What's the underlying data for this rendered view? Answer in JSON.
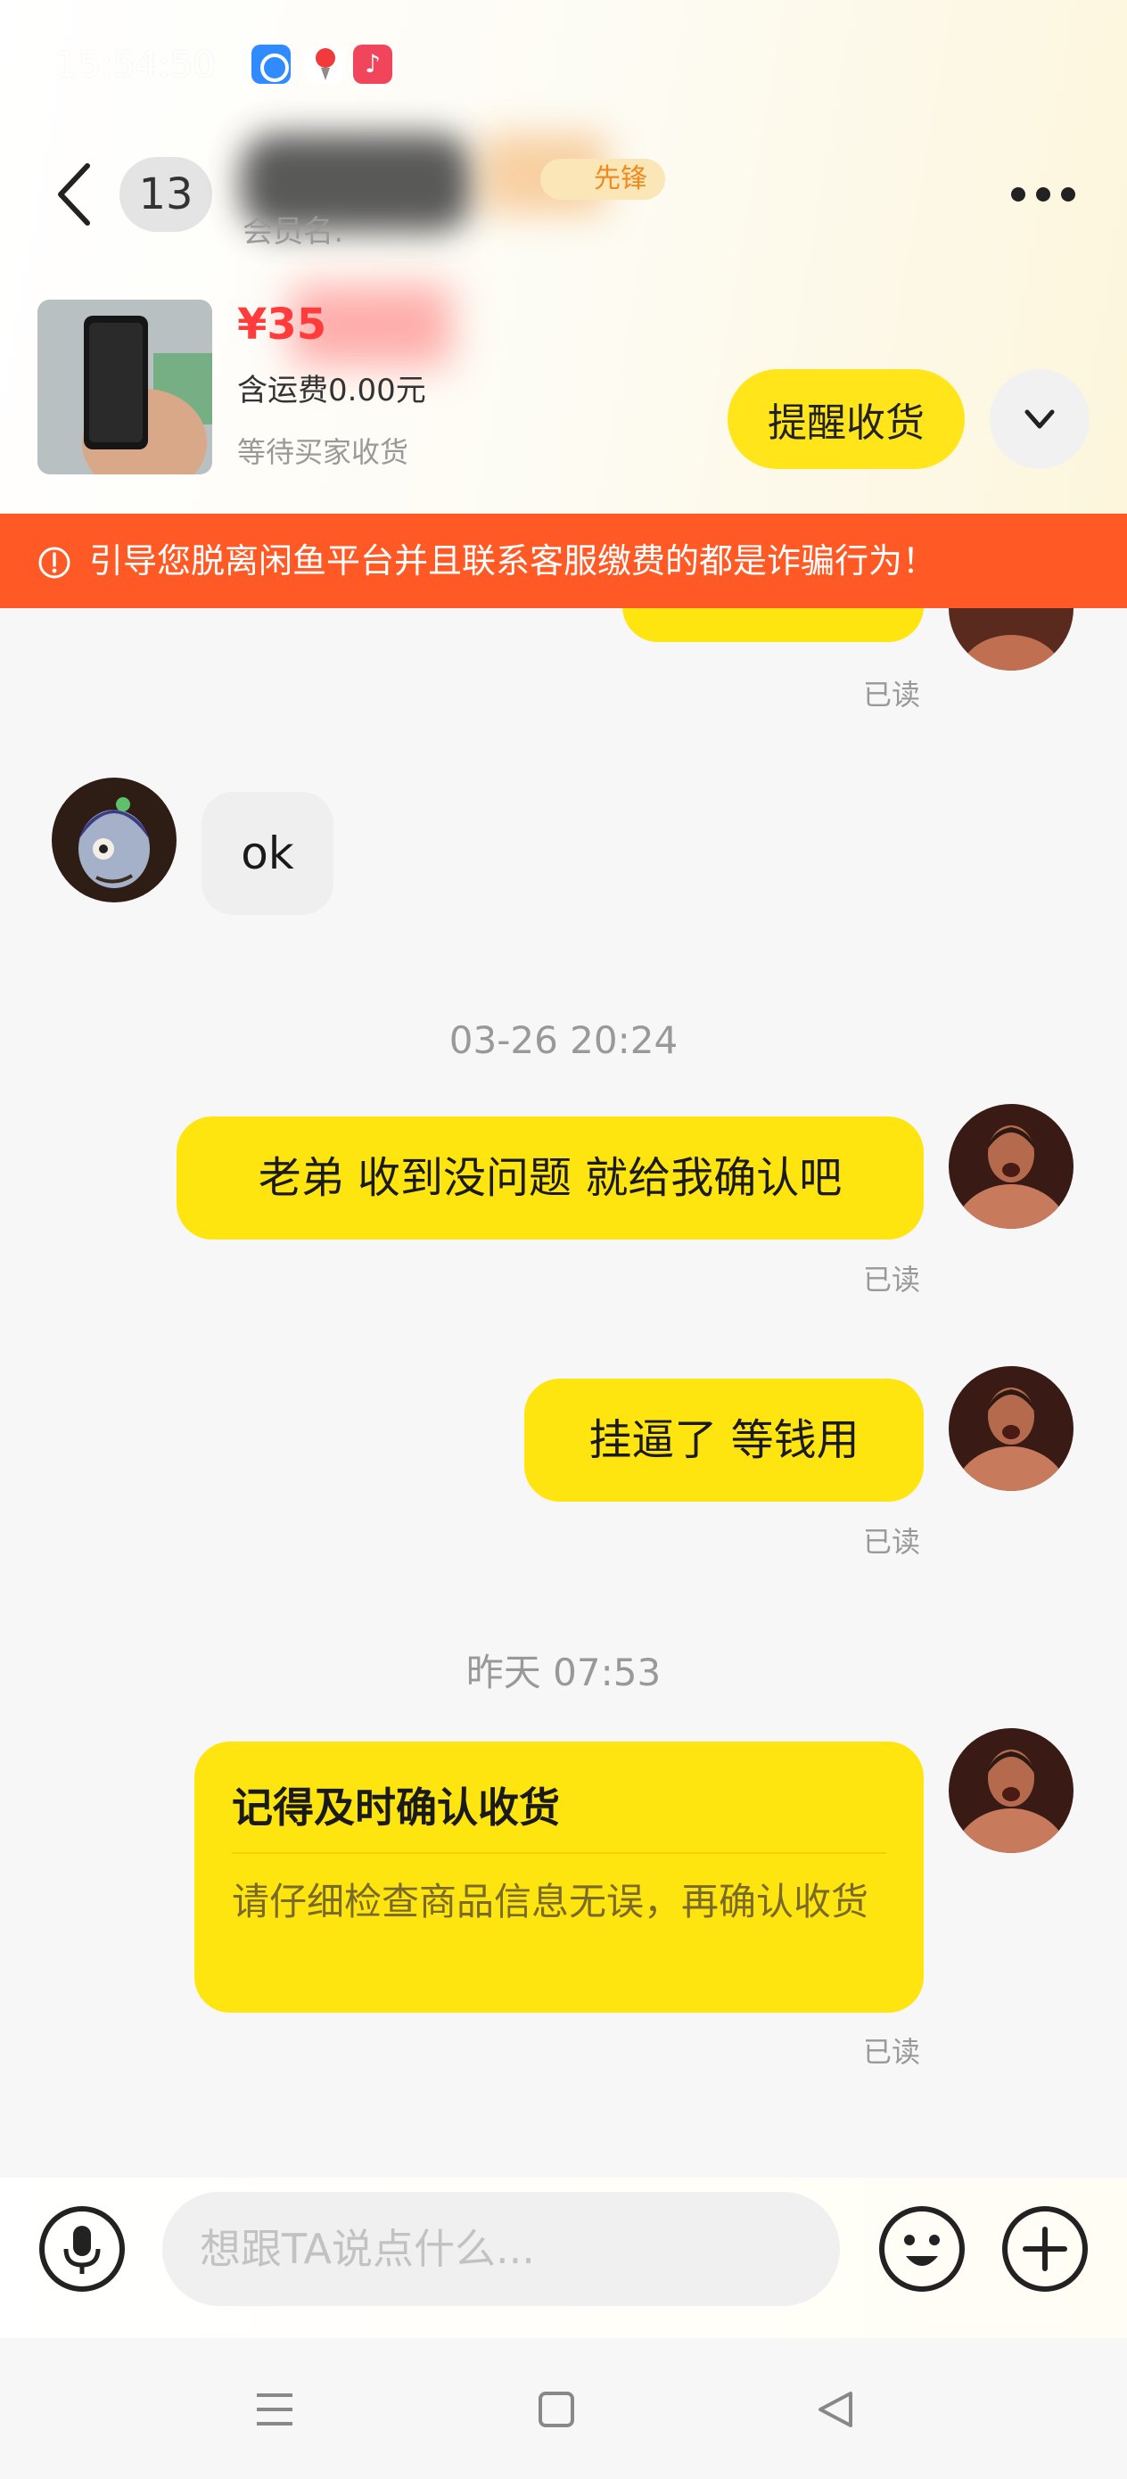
{
  "status_bar": {
    "time": "15:54:50",
    "apps": [
      "qq-app-icon",
      "dewu-app-icon",
      "music-app-icon"
    ]
  },
  "header": {
    "unread_count": "13",
    "seller_badge": "先锋",
    "seller_sub": "会员名: ",
    "more_icon": "more-dots-icon"
  },
  "order": {
    "price": "¥35",
    "shipping": "含运费0.00元",
    "status": "等待买家收货",
    "remind_button": "提醒收货"
  },
  "warning": {
    "text": "引导您脱离闲鱼平台并且联系客服缴费的都是诈骗行为！",
    "color": "#ff5a26"
  },
  "messages": {
    "top_read": "已读",
    "ok_text": "ok",
    "time_1": "03-26 20:24",
    "msg_1": "老弟 收到没问题 就给我确认吧",
    "read_1": "已读",
    "msg_2": "挂逼了  等钱用",
    "read_2": "已读",
    "time_2": "昨天 07:53",
    "card_title": "记得及时确认收货",
    "card_body": "请仔细检查商品信息无误，再确认收货",
    "read_3": "已读"
  },
  "input": {
    "placeholder": "想跟TA说点什么..."
  },
  "colors": {
    "accent_yellow": "#ffe50f",
    "price_red": "#ff3b3b",
    "warning_orange": "#ff5a26"
  }
}
